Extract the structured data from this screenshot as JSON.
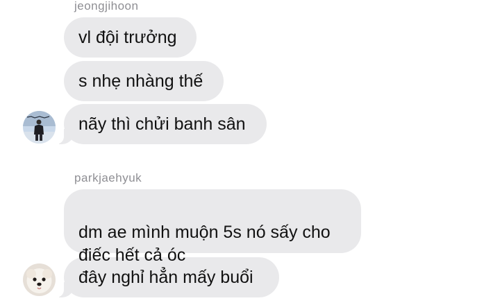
{
  "groups": [
    {
      "sender": "jeongjihoon",
      "messages": [
        "vl đội trưởng",
        "s nhẹ nhàng thế",
        "nãy thì chửi banh sân"
      ]
    },
    {
      "sender": "parkjaehyuk",
      "messages": [
        "dm ae mình muộn 5s nó sấy cho\nđiếc hết cả óc",
        "đây nghỉ hẳn mấy buổi"
      ]
    }
  ],
  "colors": {
    "bubble": "#e9e9eb",
    "sender_text": "#8e8e93",
    "message_text": "#111111"
  },
  "avatars": [
    "person-photo-avatar",
    "dog-photo-avatar"
  ]
}
